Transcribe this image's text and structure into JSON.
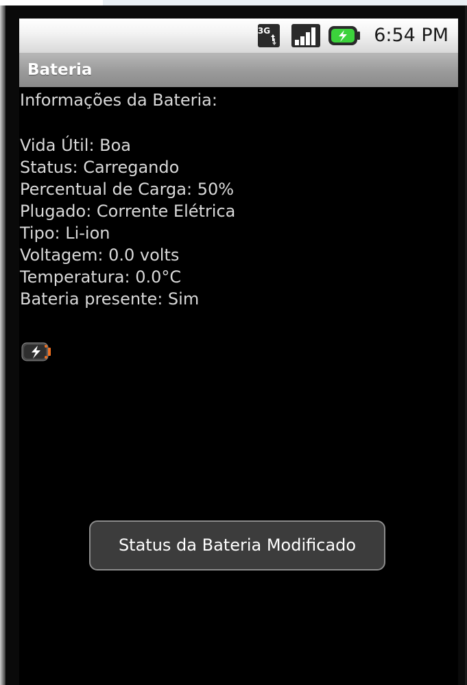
{
  "status_bar": {
    "network_type": "3G",
    "icons": [
      "network-3g-icon",
      "signal-strength-icon",
      "battery-charging-icon"
    ],
    "time": "6:54 PM"
  },
  "title_bar": {
    "title": "Bateria"
  },
  "content": {
    "heading": "Informações da Bateria:",
    "lines": [
      "Vida Útil: Boa",
      "Status: Carregando",
      "Percentual de Carga: 50%",
      "Plugado: Corrente Elétrica",
      "Tipo: Li-ion",
      "Voltagem: 0.0 volts",
      "Temperatura: 0.0°C",
      "Bateria presente: Sim"
    ],
    "battery_icon": "battery-charging-icon"
  },
  "toast": {
    "message": "Status da Bateria Modificado"
  },
  "colors": {
    "screen_background": "#000000",
    "text": "#d9d9d9",
    "title_bar": "#9a9a9a",
    "battery_accent": "#f07020",
    "charge_green": "#3cd23c"
  }
}
